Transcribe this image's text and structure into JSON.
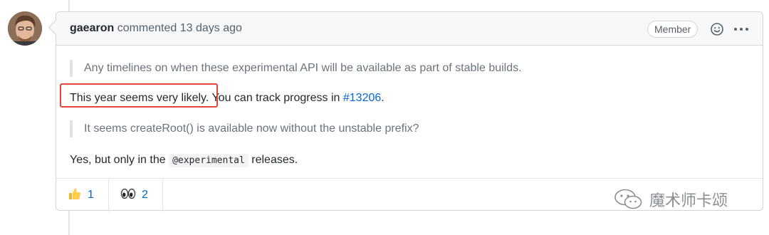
{
  "comment": {
    "author": "gaearon",
    "action": "commented",
    "time": "13 days ago",
    "badge": "Member",
    "quote1": "Any timelines on when these experimental API will be available as part of stable builds.",
    "para1_highlight": "This year seems very likely.",
    "para1_rest": " You can track progress in ",
    "para1_link": "#13206",
    "para1_end": ".",
    "quote2": "It seems createRoot() is available now without the unstable prefix?",
    "para2_start": "Yes, but only in the ",
    "para2_code": "@experimental",
    "para2_end": " releases."
  },
  "reactions": [
    {
      "emoji": "thumbs-up",
      "count": "1"
    },
    {
      "emoji": "eyes",
      "count": "2"
    }
  ],
  "watermark": {
    "text": "魔术师卡颂"
  },
  "colors": {
    "link": "#0366d6",
    "highlight_border": "#e0463a",
    "header_bg": "#f6f8fa",
    "border": "#d1d5da"
  }
}
